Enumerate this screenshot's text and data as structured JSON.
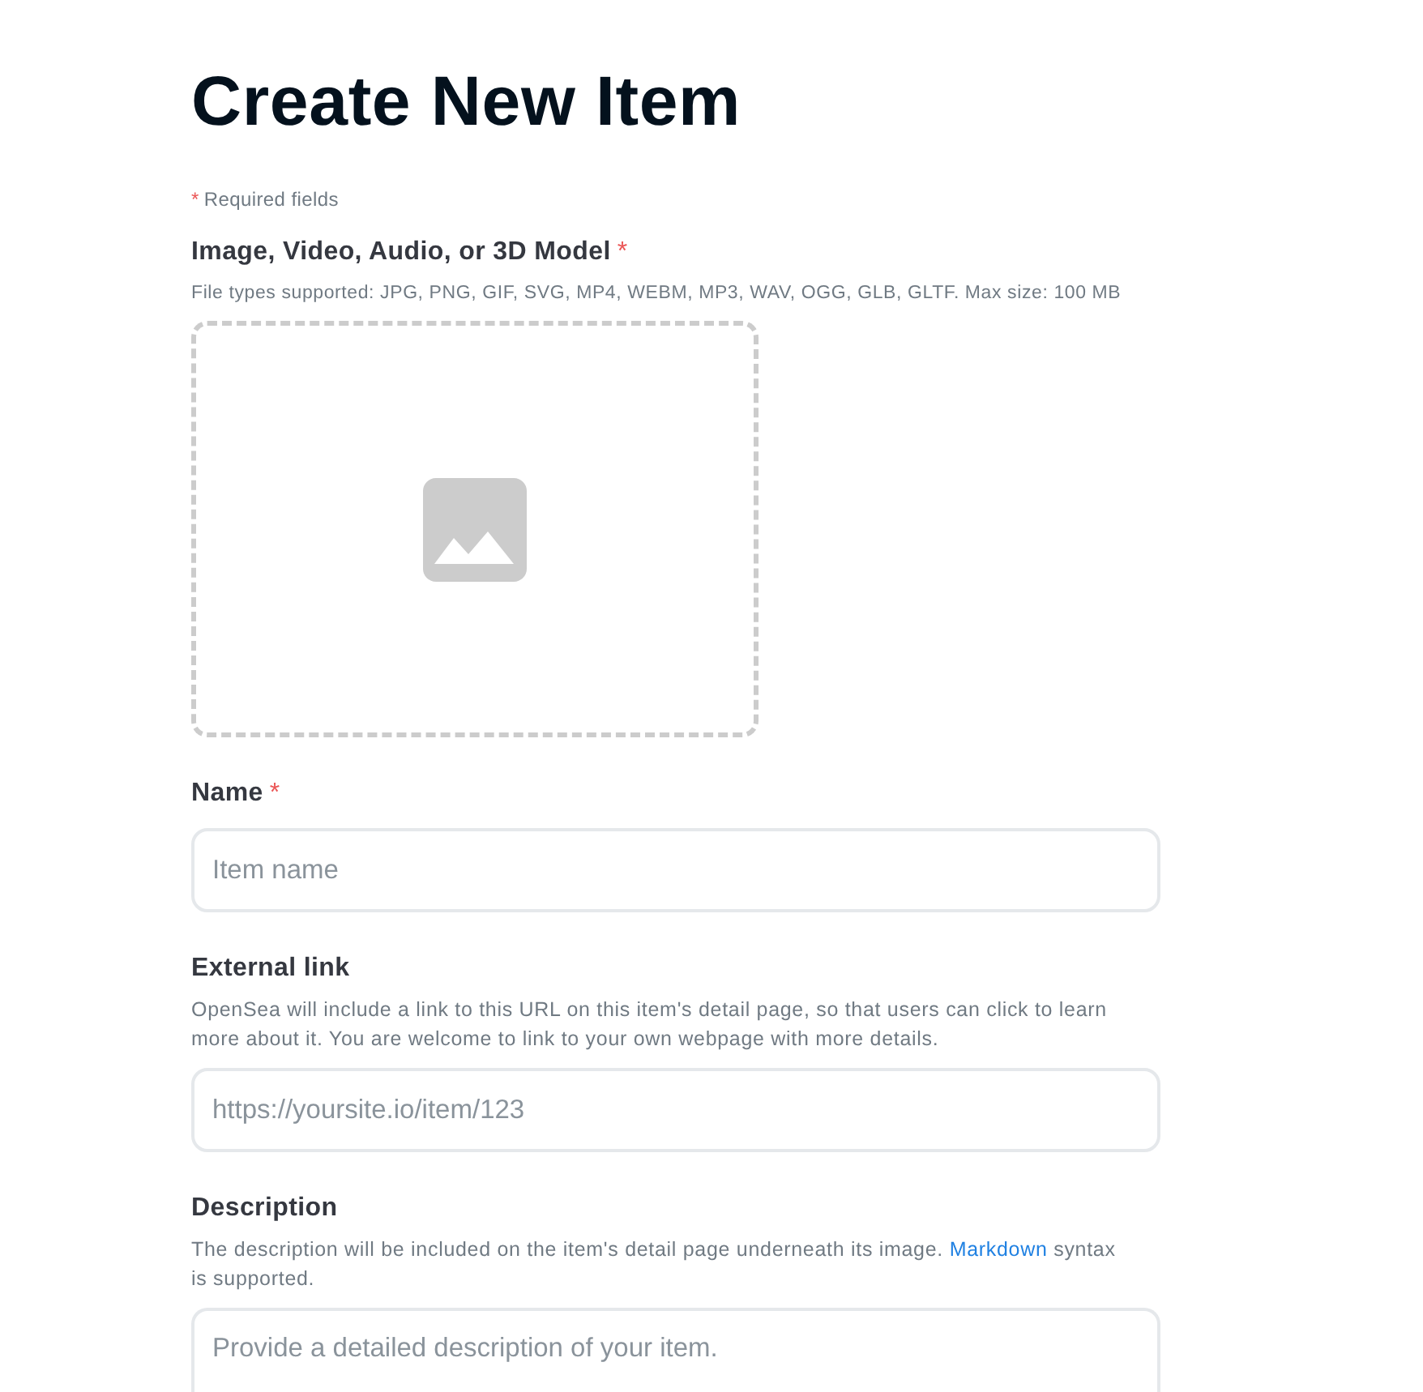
{
  "page": {
    "title": "Create New Item"
  },
  "required_note": {
    "mark": "*",
    "text": "Required fields"
  },
  "fields": [
    {
      "kind": "upload",
      "label": "Image, Video, Audio, or 3D Model",
      "required_mark": "*",
      "help": "File types supported: JPG, PNG, GIF, SVG, MP4, WEBM, MP3, WAV, OGG, GLB, GLTF. Max size: 100 MB"
    },
    {
      "kind": "input",
      "label": "Name",
      "required_mark": "*",
      "placeholder": "Item name"
    },
    {
      "kind": "input",
      "label": "External link",
      "help": "OpenSea will include a link to this URL on this item's detail page, so that users can click to learn more about it. You are welcome to link to your own webpage with more details.",
      "placeholder": "https://yoursite.io/item/123"
    },
    {
      "kind": "textarea",
      "label": "Description",
      "help": "The description will be included on the item's detail page underneath its image.",
      "help_link": "Markdown",
      "help_after": "syntax is supported.",
      "placeholder": "Provide a detailed description of your item."
    }
  ]
}
